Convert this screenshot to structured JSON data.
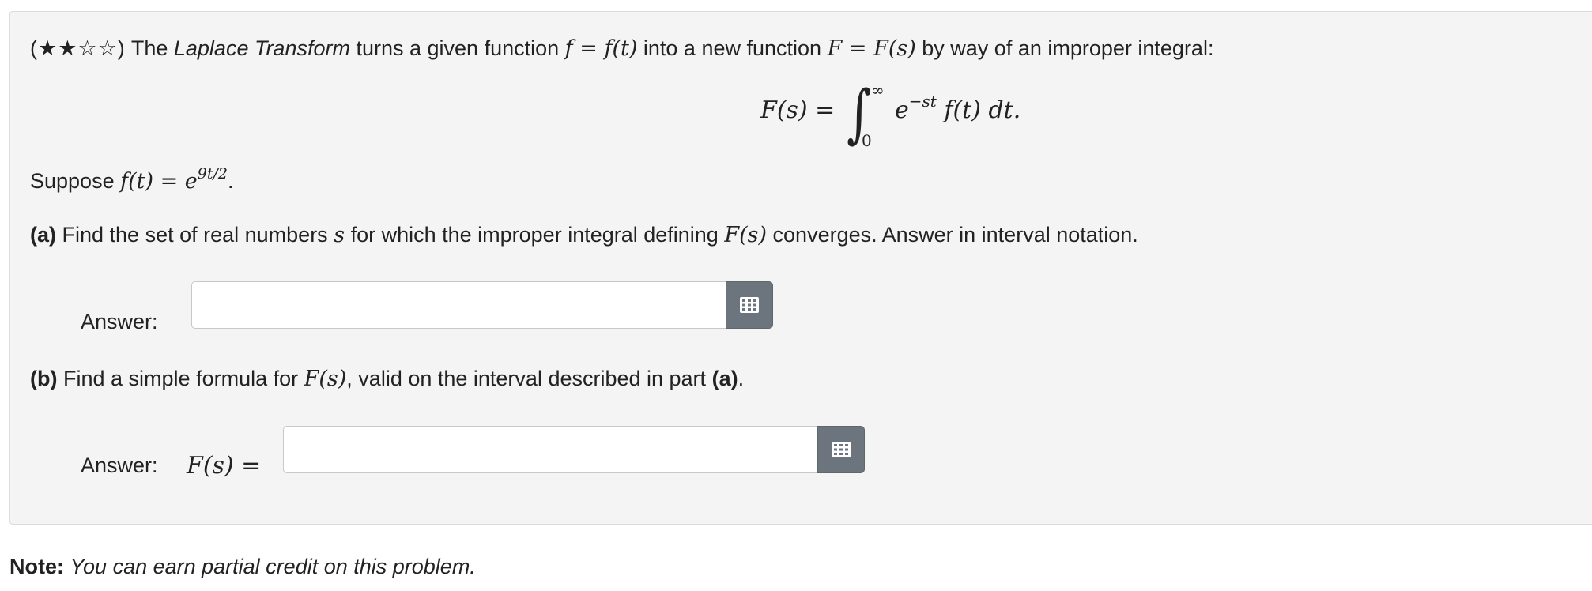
{
  "problem": {
    "difficulty": "(★★☆☆)",
    "intro": {
      "text1": "The",
      "emph": "Laplace Transform",
      "text2": "turns a given function",
      "math1": "f = f(t)",
      "text3": "into a new function",
      "math2": "F = F(s)",
      "text4": "by way of an improper integral:"
    },
    "display_formula": {
      "lhs": "F(s) =",
      "integral_sign": "∫",
      "upper_limit": "∞",
      "lower_limit": "0",
      "integrand_base": "e",
      "integrand_exp": "−st",
      "integrand_rest": "f(t) dt."
    },
    "suppose": {
      "text": "Suppose",
      "lhs": "f(t) = e",
      "exp": "9t/2",
      "end": "."
    }
  },
  "part_a": {
    "label": "(a)",
    "text1": "Find the set of real numbers",
    "math_s": "s",
    "text2": "for which the improper integral defining",
    "math_F": "F(s)",
    "text3": "converges. Answer in interval notation.",
    "answer_label": "Answer:",
    "input_value": ""
  },
  "part_b": {
    "label": "(b)",
    "text1": "Find a simple formula for",
    "math_F": "F(s)",
    "text2": ", valid on the interval described in part",
    "ref": "(a)",
    "end": ".",
    "answer_label": "Answer:",
    "lhs": "F(s) =",
    "input_value": ""
  },
  "note": {
    "label": "Note:",
    "text": "You can earn partial credit on this problem."
  },
  "colors": {
    "card_background": "#f4f4f4",
    "button_background": "#6c757d",
    "icon": "keyboard-grid-icon"
  }
}
